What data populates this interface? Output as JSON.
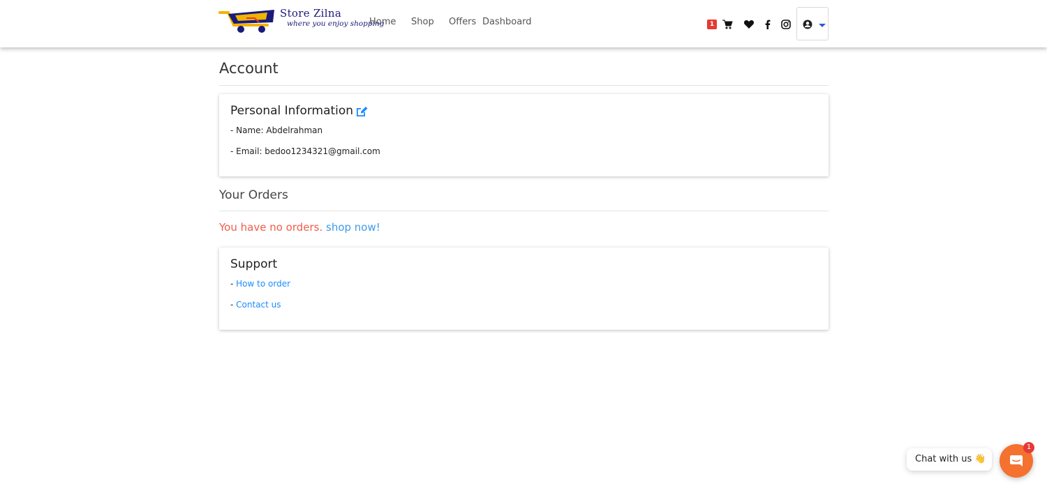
{
  "brand": {
    "name": "Store Zilna",
    "tagline": "where you enjoy shopping"
  },
  "nav": {
    "links": [
      "Home",
      "Shop",
      "Offers",
      "Dashboard"
    ],
    "cart_count": "1",
    "icons": [
      "cart-icon",
      "heart-icon",
      "facebook-icon",
      "instagram-icon",
      "user-circle-icon",
      "caret-down-icon"
    ]
  },
  "page": {
    "title": "Account"
  },
  "personal": {
    "title": "Personal Information",
    "name_line": "- Name: Abdelrahman",
    "email_line": "- Email: bedoo1234321@gmail.com"
  },
  "orders": {
    "title": "Your Orders",
    "empty_text": "You have no orders.",
    "shop_link": "shop now!"
  },
  "support": {
    "title": "Support",
    "prefix": "- ",
    "how_to_order": "How to order",
    "contact_us": "Contact us"
  },
  "chat": {
    "label": "Chat with us",
    "emoji": "👋",
    "badge": "1"
  },
  "colors": {
    "accent_link": "#1a8cff",
    "error_text": "#ef5d4a",
    "chat_button": "#f4712f",
    "badge_red": "#e53935"
  }
}
